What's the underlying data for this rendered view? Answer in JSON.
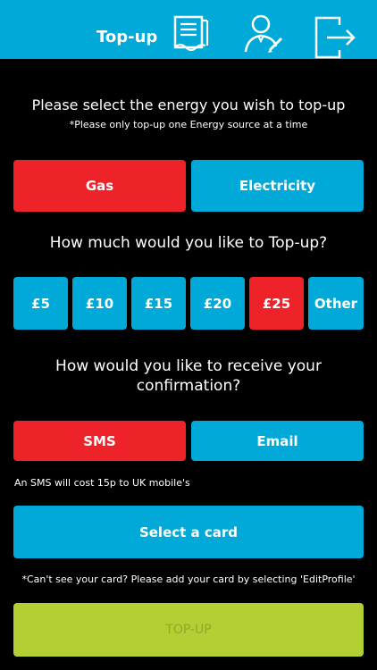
{
  "header": {
    "title": "Top-up",
    "icons": [
      "receipt-icon",
      "profile-edit-icon",
      "logout-icon"
    ]
  },
  "energy": {
    "heading": "Please select the energy you wish to top-up",
    "subheading": "*Please only top-up one Energy source at a time",
    "options": [
      {
        "label": "Gas",
        "selected": true
      },
      {
        "label": "Electricity",
        "selected": false
      }
    ]
  },
  "amount": {
    "heading": "How much would you like to Top-up?",
    "options": [
      {
        "label": "£5",
        "selected": false
      },
      {
        "label": "£10",
        "selected": false
      },
      {
        "label": "£15",
        "selected": false
      },
      {
        "label": "£20",
        "selected": false
      },
      {
        "label": "£25",
        "selected": true
      },
      {
        "label": "Other",
        "selected": false
      }
    ]
  },
  "confirmation": {
    "heading_line1": "How would you like to receive your",
    "heading_line2": "confirmation?",
    "options": [
      {
        "label": "SMS",
        "selected": true
      },
      {
        "label": "Email",
        "selected": false
      }
    ],
    "sms_note": "An SMS will cost 15p to UK mobile's"
  },
  "card": {
    "button_label": "Select a card",
    "note": "*Can't see your card? Please add your card by selecting 'EditProfile'"
  },
  "submit": {
    "label": "TOP-UP"
  },
  "colors": {
    "accent_blue": "#00a9d8",
    "selected_red": "#ee2229",
    "submit_green": "#b2cf33"
  }
}
